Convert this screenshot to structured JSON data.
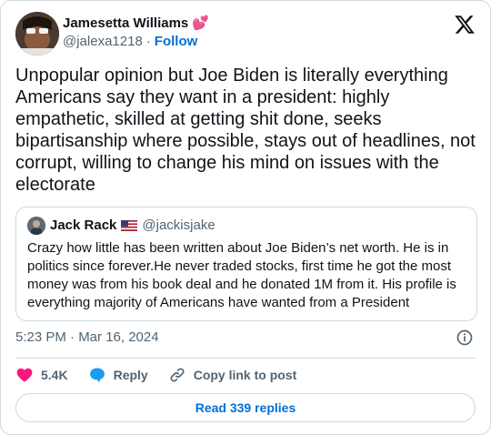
{
  "author": {
    "name": "Jamesetta Williams",
    "emoji": "💕",
    "handle": "@jalexa1218",
    "separator": "·",
    "follow_label": "Follow"
  },
  "tweet": {
    "text": "Unpopular opinion but Joe Biden is literally everything Americans say they want in a president: highly empathetic, skilled at getting shit done, seeks bipartisanship where possible, stays out of headlines, not corrupt, willing to change his mind on issues with the electorate"
  },
  "quoted": {
    "name": "Jack Rack",
    "handle": "@jackisjake",
    "text": "Crazy how little has been written about Joe Biden’s net worth. He is in politics since forever.He never traded stocks, first time he got the most money was from his book deal and he donated 1M from it. His profile is everything majority of Americans have wanted from a President"
  },
  "meta": {
    "timestamp": "5:23 PM · Mar 16, 2024"
  },
  "actions": {
    "like_count": "5.4K",
    "reply_label": "Reply",
    "copy_label": "Copy link to post"
  },
  "footer": {
    "read_replies_label": "Read 339 replies"
  },
  "colors": {
    "like": "#f91880",
    "reply": "#1d9bf0",
    "link": "#006fd6",
    "muted": "#536471",
    "border": "#cfd9de"
  },
  "icons": [
    "x-logo-icon",
    "heart-icon",
    "reply-bubble-icon",
    "link-icon",
    "info-icon",
    "us-flag-icon"
  ]
}
